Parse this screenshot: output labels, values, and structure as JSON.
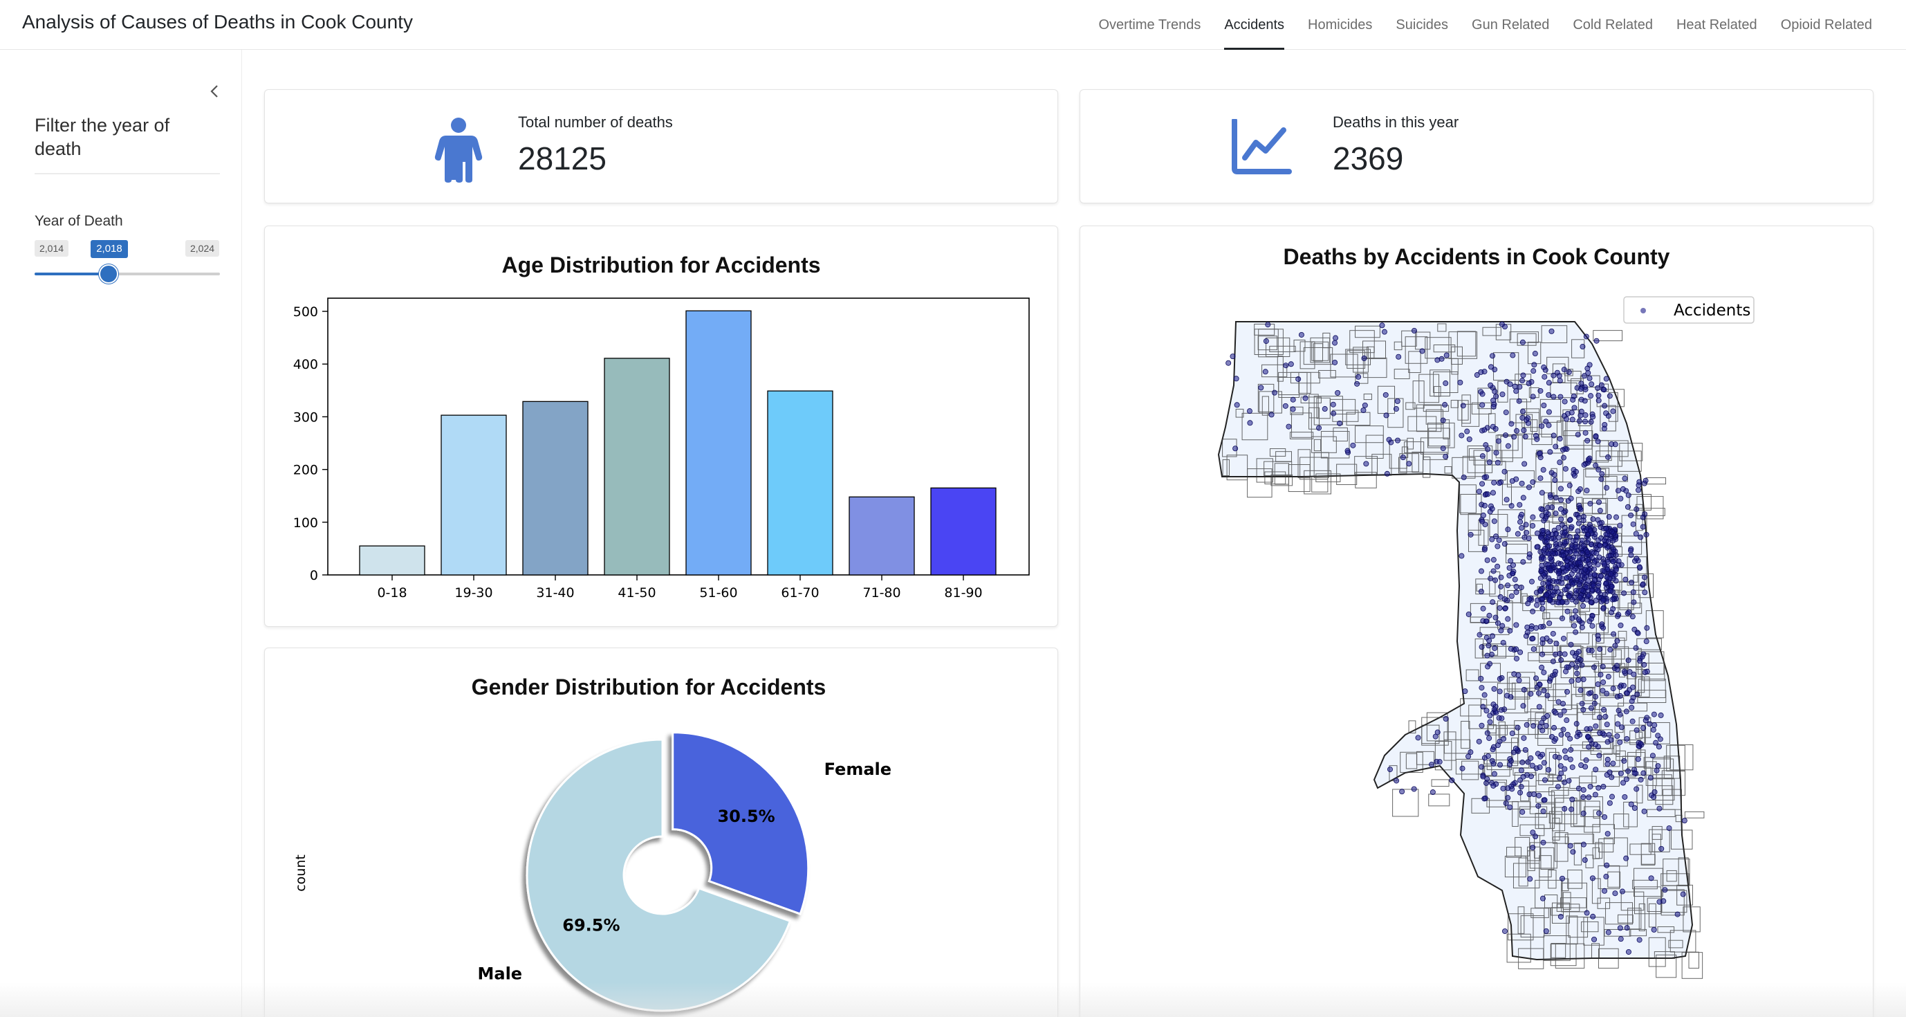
{
  "app": {
    "title": "Analysis of Causes of Deaths in Cook County"
  },
  "tabs": [
    {
      "label": "Overtime Trends",
      "active": false
    },
    {
      "label": "Accidents",
      "active": true
    },
    {
      "label": "Homicides",
      "active": false
    },
    {
      "label": "Suicides",
      "active": false
    },
    {
      "label": "Gun Related",
      "active": false
    },
    {
      "label": "Cold Related",
      "active": false
    },
    {
      "label": "Heat Related",
      "active": false
    },
    {
      "label": "Opioid Related",
      "active": false
    }
  ],
  "sidebar": {
    "collapse_icon": "chevron-left-icon",
    "title": "Filter the year of death",
    "slider": {
      "label": "Year of Death",
      "min_label": "2,014",
      "max_label": "2,024",
      "current_label": "2,018",
      "min": 2014,
      "max": 2024,
      "value": 2018,
      "color": "#2e6fbf"
    }
  },
  "kpis": {
    "total": {
      "label": "Total number of deaths",
      "value": "28125",
      "icon": "person-icon",
      "icon_color": "#4a78d0"
    },
    "year": {
      "label": "Deaths in this year",
      "value": "2369",
      "icon": "line-chart-icon",
      "icon_color": "#4a78d0"
    }
  },
  "chart_data": [
    {
      "type": "bar",
      "title": "Age Distribution for Accidents",
      "categories": [
        "0-18",
        "19-30",
        "31-40",
        "41-50",
        "51-60",
        "61-70",
        "71-80",
        "81-90"
      ],
      "values": [
        55,
        303,
        329,
        411,
        501,
        349,
        148,
        165
      ],
      "colors": [
        "#cfe3ec",
        "#b0daf6",
        "#83a4c6",
        "#97bbbb",
        "#73acf6",
        "#6ecbfa",
        "#8090e3",
        "#4a45f3"
      ],
      "yticks": [
        0,
        100,
        200,
        300,
        400,
        500
      ],
      "ylim": [
        0,
        525
      ],
      "grid": false
    },
    {
      "type": "pie",
      "title": "Gender Distribution for Accidents",
      "ylabel": "count",
      "labels": [
        "Female",
        "Male"
      ],
      "values": [
        30.5,
        69.5
      ],
      "value_labels": [
        "30.5%",
        "69.5%"
      ],
      "colors": [
        "#4a63dc",
        "#b5d7e3"
      ]
    },
    {
      "type": "scatter",
      "title": "Deaths by Accidents in Cook County",
      "legend": [
        {
          "name": "Accidents",
          "color": "#1c1c8a"
        }
      ],
      "legend_position": "top-right"
    }
  ]
}
